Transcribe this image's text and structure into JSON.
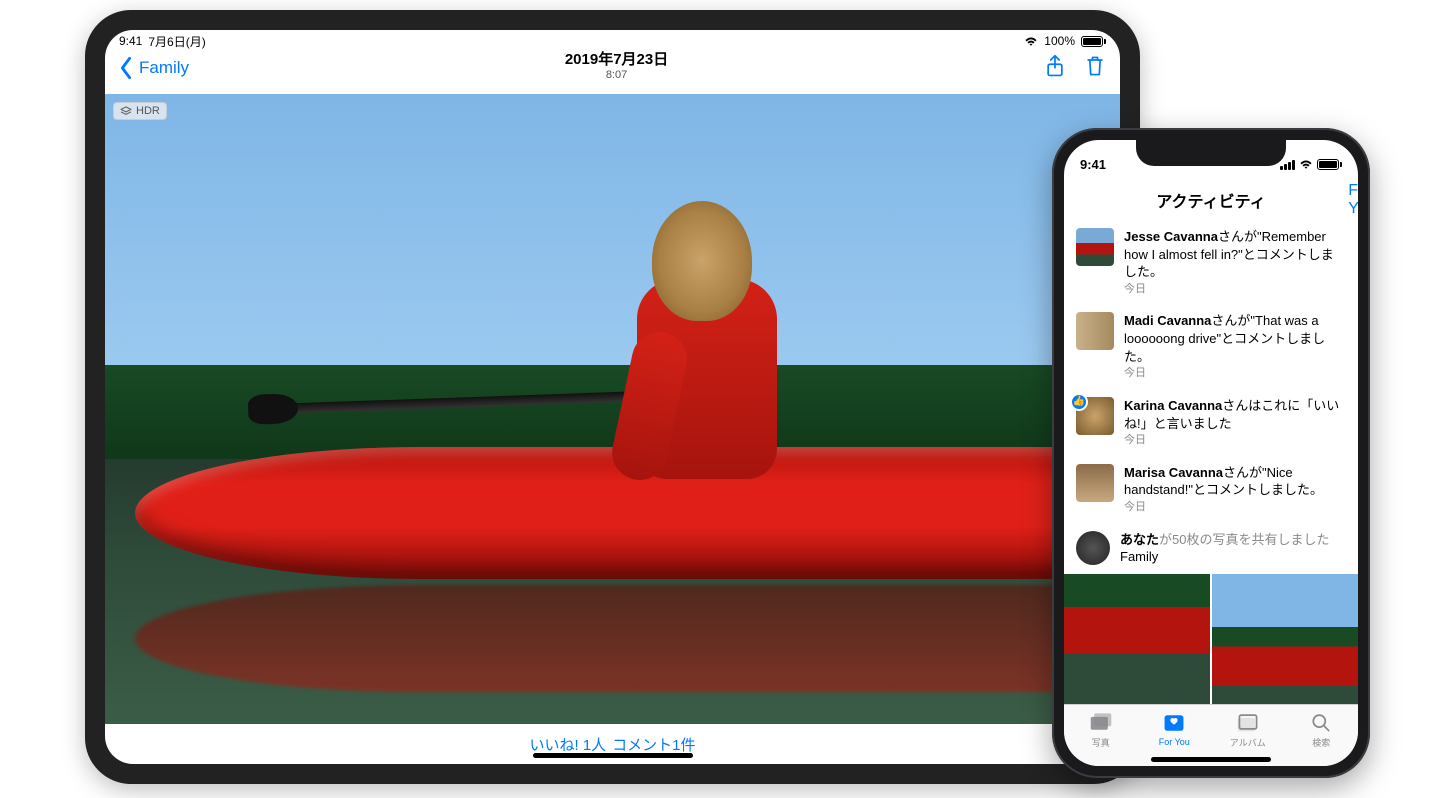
{
  "ipad": {
    "status": {
      "time": "9:41",
      "date": "7月6日(月)",
      "wifi": "100%"
    },
    "nav": {
      "back": "Family",
      "date": "2019年7月23日",
      "time": "8:07"
    },
    "hdr_badge": "HDR",
    "footer": {
      "likes": "いいね! 1人",
      "comments": "コメント1件"
    }
  },
  "iphone": {
    "status": {
      "time": "9:41"
    },
    "nav": {
      "back": "For You",
      "title": "アクティビティ"
    },
    "activity": [
      {
        "name": "Jesse Cavanna",
        "text": "さんが\"Remember how I almost fell in?\"とコメントしました。",
        "when": "今日",
        "thumb": "t1"
      },
      {
        "name": "Madi Cavanna",
        "text": "さんが\"That was a loooooong drive\"とコメントしました。",
        "when": "今日",
        "thumb": "t2"
      },
      {
        "name": "Karina Cavanna",
        "text": "さんはこれに「いいね!」と言いました",
        "when": "今日",
        "thumb": "t3",
        "liked": true
      },
      {
        "name": "Marisa Cavanna",
        "text": "さんが\"Nice handstand!\"とコメントしました。",
        "when": "今日",
        "thumb": "t4"
      }
    ],
    "share": {
      "you": "あなた",
      "rest": "が50枚の写真を共有しました",
      "album": "Family"
    },
    "tabs": {
      "photos": "写真",
      "foryou": "For You",
      "albums": "アルバム",
      "search": "検索"
    }
  }
}
